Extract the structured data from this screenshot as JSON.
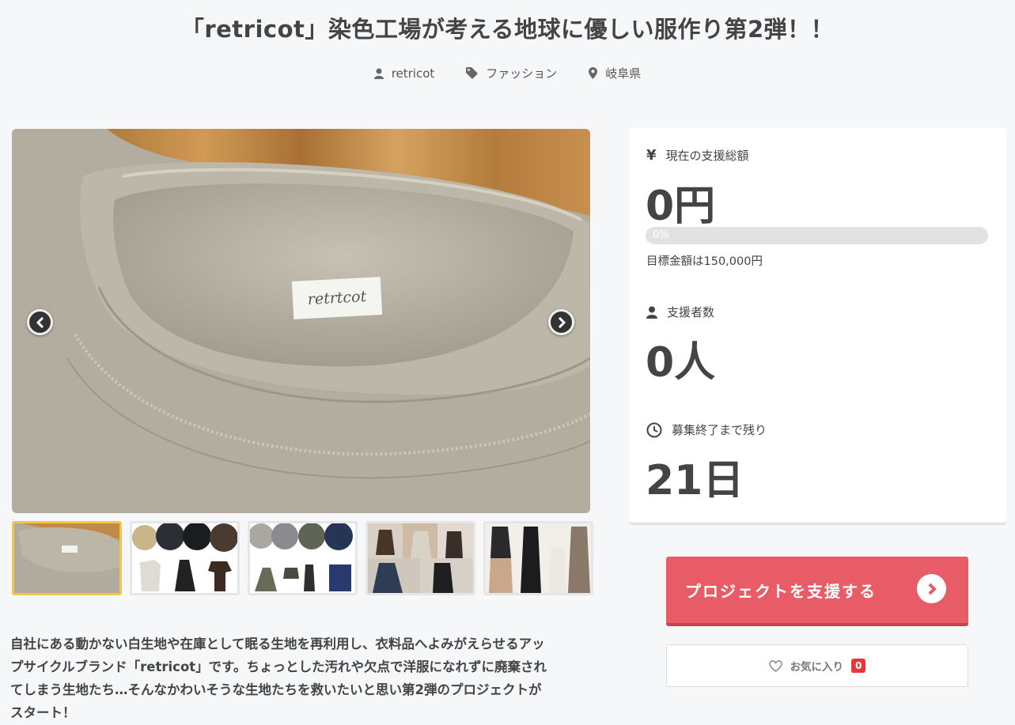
{
  "project": {
    "title": "「retricot」染色工場が考える地球に優しい服作り第2弾！！",
    "owner": "retricot",
    "category": "ファッション",
    "location": "岐阜県",
    "description": "自社にある動かない白生地や在庫として眠る生地を再利用し、衣料品へよみがえらせるアップサイクルブランド「retricot」です。ちょっとした汚れや欠点で洋服になれずに廃棄されてしまう生地たち…そんなかわいそうな生地たちを救いたいと思い第2弾のプロジェクトがスタート！",
    "description_lines": [
      "自社にある動かない白生地や在庫として眠る生地を再利用し、衣料品へよみがえらせるアッ",
      "プサイクルブランド「retricot」です。ちょっとした汚れや欠点で洋服になれずに廃棄され",
      "てしまう生地たち…そんなかわいそうな生地たちを救いたいと思い第2弾のプロジェクトが",
      "スタート！"
    ]
  },
  "gallery": {
    "label_text": "retrtcot",
    "thumbnails": [
      {
        "alt": "sweatshirt collar closeup",
        "active": true
      },
      {
        "alt": "fabric swatches and garments 1",
        "active": false
      },
      {
        "alt": "fabric swatches and garments 2",
        "active": false
      },
      {
        "alt": "model wearing garments",
        "active": false
      },
      {
        "alt": "dresses and outerwear",
        "active": false
      }
    ]
  },
  "stats": {
    "total_label": "現在の支援総額",
    "currency_symbol": "¥",
    "total_value": "0円",
    "progress_text": "0%",
    "progress_fraction": 0,
    "goal_text": "目標金額は150,000円",
    "backers_label": "支援者数",
    "backers_value": "0人",
    "remaining_label": "募集終了まで残り",
    "remaining_value": "21日"
  },
  "actions": {
    "support_label": "プロジェクトを支援する",
    "favorite_label": "お気に入り",
    "favorite_count": "0"
  },
  "colors": {
    "accent": "#e85c67",
    "badge": "#e3393a",
    "active_thumb_border": "#f3c64a"
  },
  "icons": [
    "user-icon",
    "tag-icon",
    "map-pin-icon",
    "yen-icon",
    "clock-icon",
    "chevron-left-icon",
    "chevron-right-icon",
    "heart-icon"
  ]
}
